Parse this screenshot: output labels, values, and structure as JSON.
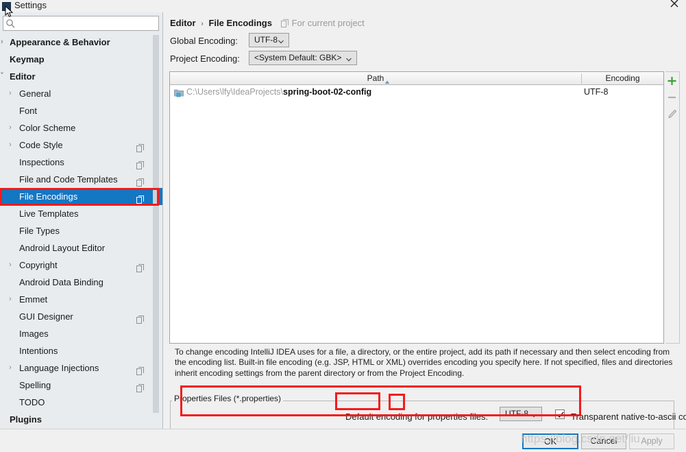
{
  "window": {
    "title": "Settings",
    "close_label": "✕",
    "app_icon": "intellij-app-icon"
  },
  "sidebar": {
    "search": {
      "value": "",
      "placeholder": ""
    },
    "items": [
      {
        "label": "Appearance & Behavior",
        "level": "top",
        "arrow": true,
        "check": false,
        "copy": false,
        "selected": false
      },
      {
        "label": "Keymap",
        "level": "top",
        "arrow": false,
        "check": false,
        "copy": false,
        "selected": false
      },
      {
        "label": "Editor",
        "level": "top",
        "arrow": false,
        "check": true,
        "copy": false,
        "selected": false
      },
      {
        "label": "General",
        "level": "lvl1",
        "arrow": true,
        "check": false,
        "copy": false,
        "selected": false
      },
      {
        "label": "Font",
        "level": "lvl1",
        "arrow": false,
        "check": false,
        "copy": false,
        "selected": false
      },
      {
        "label": "Color Scheme",
        "level": "lvl1",
        "arrow": true,
        "check": false,
        "copy": false,
        "selected": false
      },
      {
        "label": "Code Style",
        "level": "lvl1",
        "arrow": true,
        "check": false,
        "copy": true,
        "selected": false
      },
      {
        "label": "Inspections",
        "level": "lvl1",
        "arrow": false,
        "check": false,
        "copy": true,
        "selected": false
      },
      {
        "label": "File and Code Templates",
        "level": "lvl1",
        "arrow": false,
        "check": false,
        "copy": true,
        "selected": false
      },
      {
        "label": "File Encodings",
        "level": "lvl1",
        "arrow": false,
        "check": false,
        "copy": true,
        "selected": true
      },
      {
        "label": "Live Templates",
        "level": "lvl1",
        "arrow": false,
        "check": false,
        "copy": false,
        "selected": false
      },
      {
        "label": "File Types",
        "level": "lvl1",
        "arrow": false,
        "check": false,
        "copy": false,
        "selected": false
      },
      {
        "label": "Android Layout Editor",
        "level": "lvl1",
        "arrow": false,
        "check": false,
        "copy": false,
        "selected": false
      },
      {
        "label": "Copyright",
        "level": "lvl1",
        "arrow": true,
        "check": false,
        "copy": true,
        "selected": false
      },
      {
        "label": "Android Data Binding",
        "level": "lvl1",
        "arrow": false,
        "check": false,
        "copy": false,
        "selected": false
      },
      {
        "label": "Emmet",
        "level": "lvl1",
        "arrow": true,
        "check": false,
        "copy": false,
        "selected": false
      },
      {
        "label": "GUI Designer",
        "level": "lvl1",
        "arrow": false,
        "check": false,
        "copy": true,
        "selected": false
      },
      {
        "label": "Images",
        "level": "lvl1",
        "arrow": false,
        "check": false,
        "copy": false,
        "selected": false
      },
      {
        "label": "Intentions",
        "level": "lvl1",
        "arrow": false,
        "check": false,
        "copy": false,
        "selected": false
      },
      {
        "label": "Language Injections",
        "level": "lvl1",
        "arrow": true,
        "check": false,
        "copy": true,
        "selected": false
      },
      {
        "label": "Spelling",
        "level": "lvl1",
        "arrow": false,
        "check": false,
        "copy": true,
        "selected": false
      },
      {
        "label": "TODO",
        "level": "lvl1",
        "arrow": false,
        "check": false,
        "copy": false,
        "selected": false
      },
      {
        "label": "Plugins",
        "level": "top",
        "arrow": false,
        "check": false,
        "copy": false,
        "selected": false
      }
    ]
  },
  "panel": {
    "breadcrumb": {
      "parent": "Editor",
      "separator": "›",
      "current": "File Encodings",
      "scope_note": "For current project",
      "scope_icon": "copy-settings-icon"
    },
    "global_encoding": {
      "label": "Global Encoding:",
      "value": "UTF-8"
    },
    "project_encoding": {
      "label": "Project Encoding:",
      "value": "<System Default: GBK>"
    },
    "table": {
      "columns": [
        "Path",
        "Encoding"
      ],
      "sort_column": "Path",
      "sort_direction": "asc",
      "rows": [
        {
          "path_prefix": "C:\\Users\\lfy\\IdeaProjects\\",
          "path_name": "spring-boot-02-config",
          "encoding": "UTF-8",
          "icon": "project-folder-icon"
        }
      ]
    },
    "tools": [
      {
        "name": "add-button",
        "glyph": "+"
      },
      {
        "name": "remove-button",
        "glyph": "–"
      },
      {
        "name": "edit-button",
        "glyph": "pencil"
      }
    ],
    "help_text": "To change encoding IntelliJ IDEA uses for a file, a directory, or the entire project, add its path if necessary and then select encoding from the encoding list. Built-in file encoding (e.g. JSP, HTML or XML) overrides encoding you specify here. If not specified, files and directories inherit encoding settings from the parent directory or from the Project Encoding.",
    "properties_group": {
      "title": "Properties Files (*.properties)",
      "default_encoding_label": "Default encoding for properties files:",
      "default_encoding_value": "UTF-8",
      "transparent_conversion_label": "Transparent native-to-ascii conversion",
      "transparent_conversion_checked": true
    }
  },
  "footer": {
    "ok": "OK",
    "cancel": "Cancel",
    "apply": "Apply"
  },
  "overlay": {
    "watermark": "https://blog.csdn.net/liu",
    "highlight_color": "#f41a1a",
    "accent_color": "#1477c4"
  }
}
